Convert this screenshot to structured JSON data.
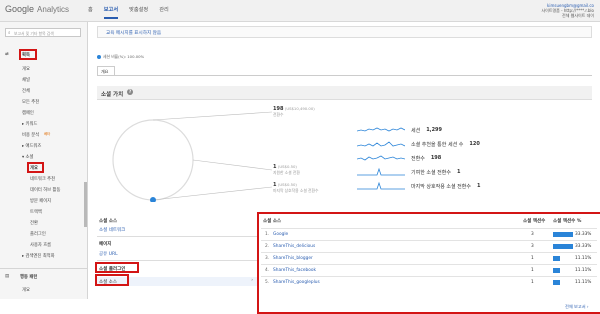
{
  "header": {
    "logo_google": "Google",
    "logo_analytics": "Analytics",
    "nav": [
      "홈",
      "보고서",
      "맞춤설정",
      "관리"
    ],
    "active_nav": "보고서",
    "account_email": "kimsuengbm@gmail.co",
    "account_line2": "사이트명품 - http://****.r.blo",
    "account_line3": "전체 웹사이트 데이"
  },
  "sidebar": {
    "search_placeholder": "보고서 및 기타 항목 검색",
    "items": {
      "acquisition": "획득",
      "overview": "개요",
      "channels": "채널",
      "all_traffic": "전체",
      "all_referrals": "모든 추천",
      "campaigns": "캠페인",
      "keywords": "▸ 키워드",
      "cost_analysis": "비용 분석",
      "cost_badge": "베타",
      "adwords": "▸ 애드워즈",
      "social": "▾ 소셜",
      "social_overview": "개요",
      "network_referrals": "네트워크 추천",
      "data_hub": "데이터 허브 활동",
      "landing_pages": "방문 페이지",
      "trackbacks": "트랙백",
      "conversions": "전환",
      "plugins": "플러그인",
      "users_flow": "사용자 흐름",
      "search_optimization": "▸ 검색엔진 최적화",
      "behavior": "행동 패턴",
      "behavior_overview": "개요"
    }
  },
  "main": {
    "notice": "교육 메시지를 표시하지 않음",
    "segment": "세션 비율(%): 100.00%",
    "tab_overview": "개요",
    "section_title": "소셜 가치",
    "ring": {
      "top_value": "198",
      "top_money": "(US$10,490.00)",
      "top_label": "전환수",
      "mid_value": "1",
      "mid_money": "(US$0.50)",
      "mid_label": "지원한 소셜 전환",
      "bot_value": "1",
      "bot_money": "(US$0.50)",
      "bot_label": "마지막 상호작용 소셜 전환수"
    },
    "metrics": [
      {
        "label": "세션",
        "value": "1,299"
      },
      {
        "label": "소셜 추천을 통한 세션 수",
        "value": "120"
      },
      {
        "label": "전환수",
        "value": "198"
      },
      {
        "label": "기여한 소셜 전환수",
        "value": "1"
      },
      {
        "label": "마지막 상호작용 소셜 전환수",
        "value": "1"
      }
    ],
    "left_panel": {
      "social_source_head": "소셜 소스",
      "social_network_link": "소셜 네트워크",
      "pages_head": "페이지",
      "shared_url_link": "공유 URL",
      "social_plugin_head": "소셜 플러그인",
      "social_source_item": "소셜 소스",
      "arrow": "›"
    },
    "table": {
      "col_source": "소셜 소스",
      "col_actions": "소셜 액션수",
      "col_percent": "소셜 액션수 %",
      "rows": [
        {
          "n": "1.",
          "source": "Google",
          "count": "3",
          "percent": "33.33%",
          "share": 0.3333
        },
        {
          "n": "2.",
          "source": "ShareThis_delicious",
          "count": "3",
          "percent": "33.33%",
          "share": 0.3333
        },
        {
          "n": "3.",
          "source": "ShareThis_blogger",
          "count": "1",
          "percent": "11.11%",
          "share": 0.1111
        },
        {
          "n": "4.",
          "source": "ShareThis_facebook",
          "count": "1",
          "percent": "11.11%",
          "share": 0.1111
        },
        {
          "n": "5.",
          "source": "ShareThis_googleplus",
          "count": "1",
          "percent": "11.11%",
          "share": 0.1111
        }
      ],
      "footer_link": "전체 보고서 ›"
    }
  }
}
